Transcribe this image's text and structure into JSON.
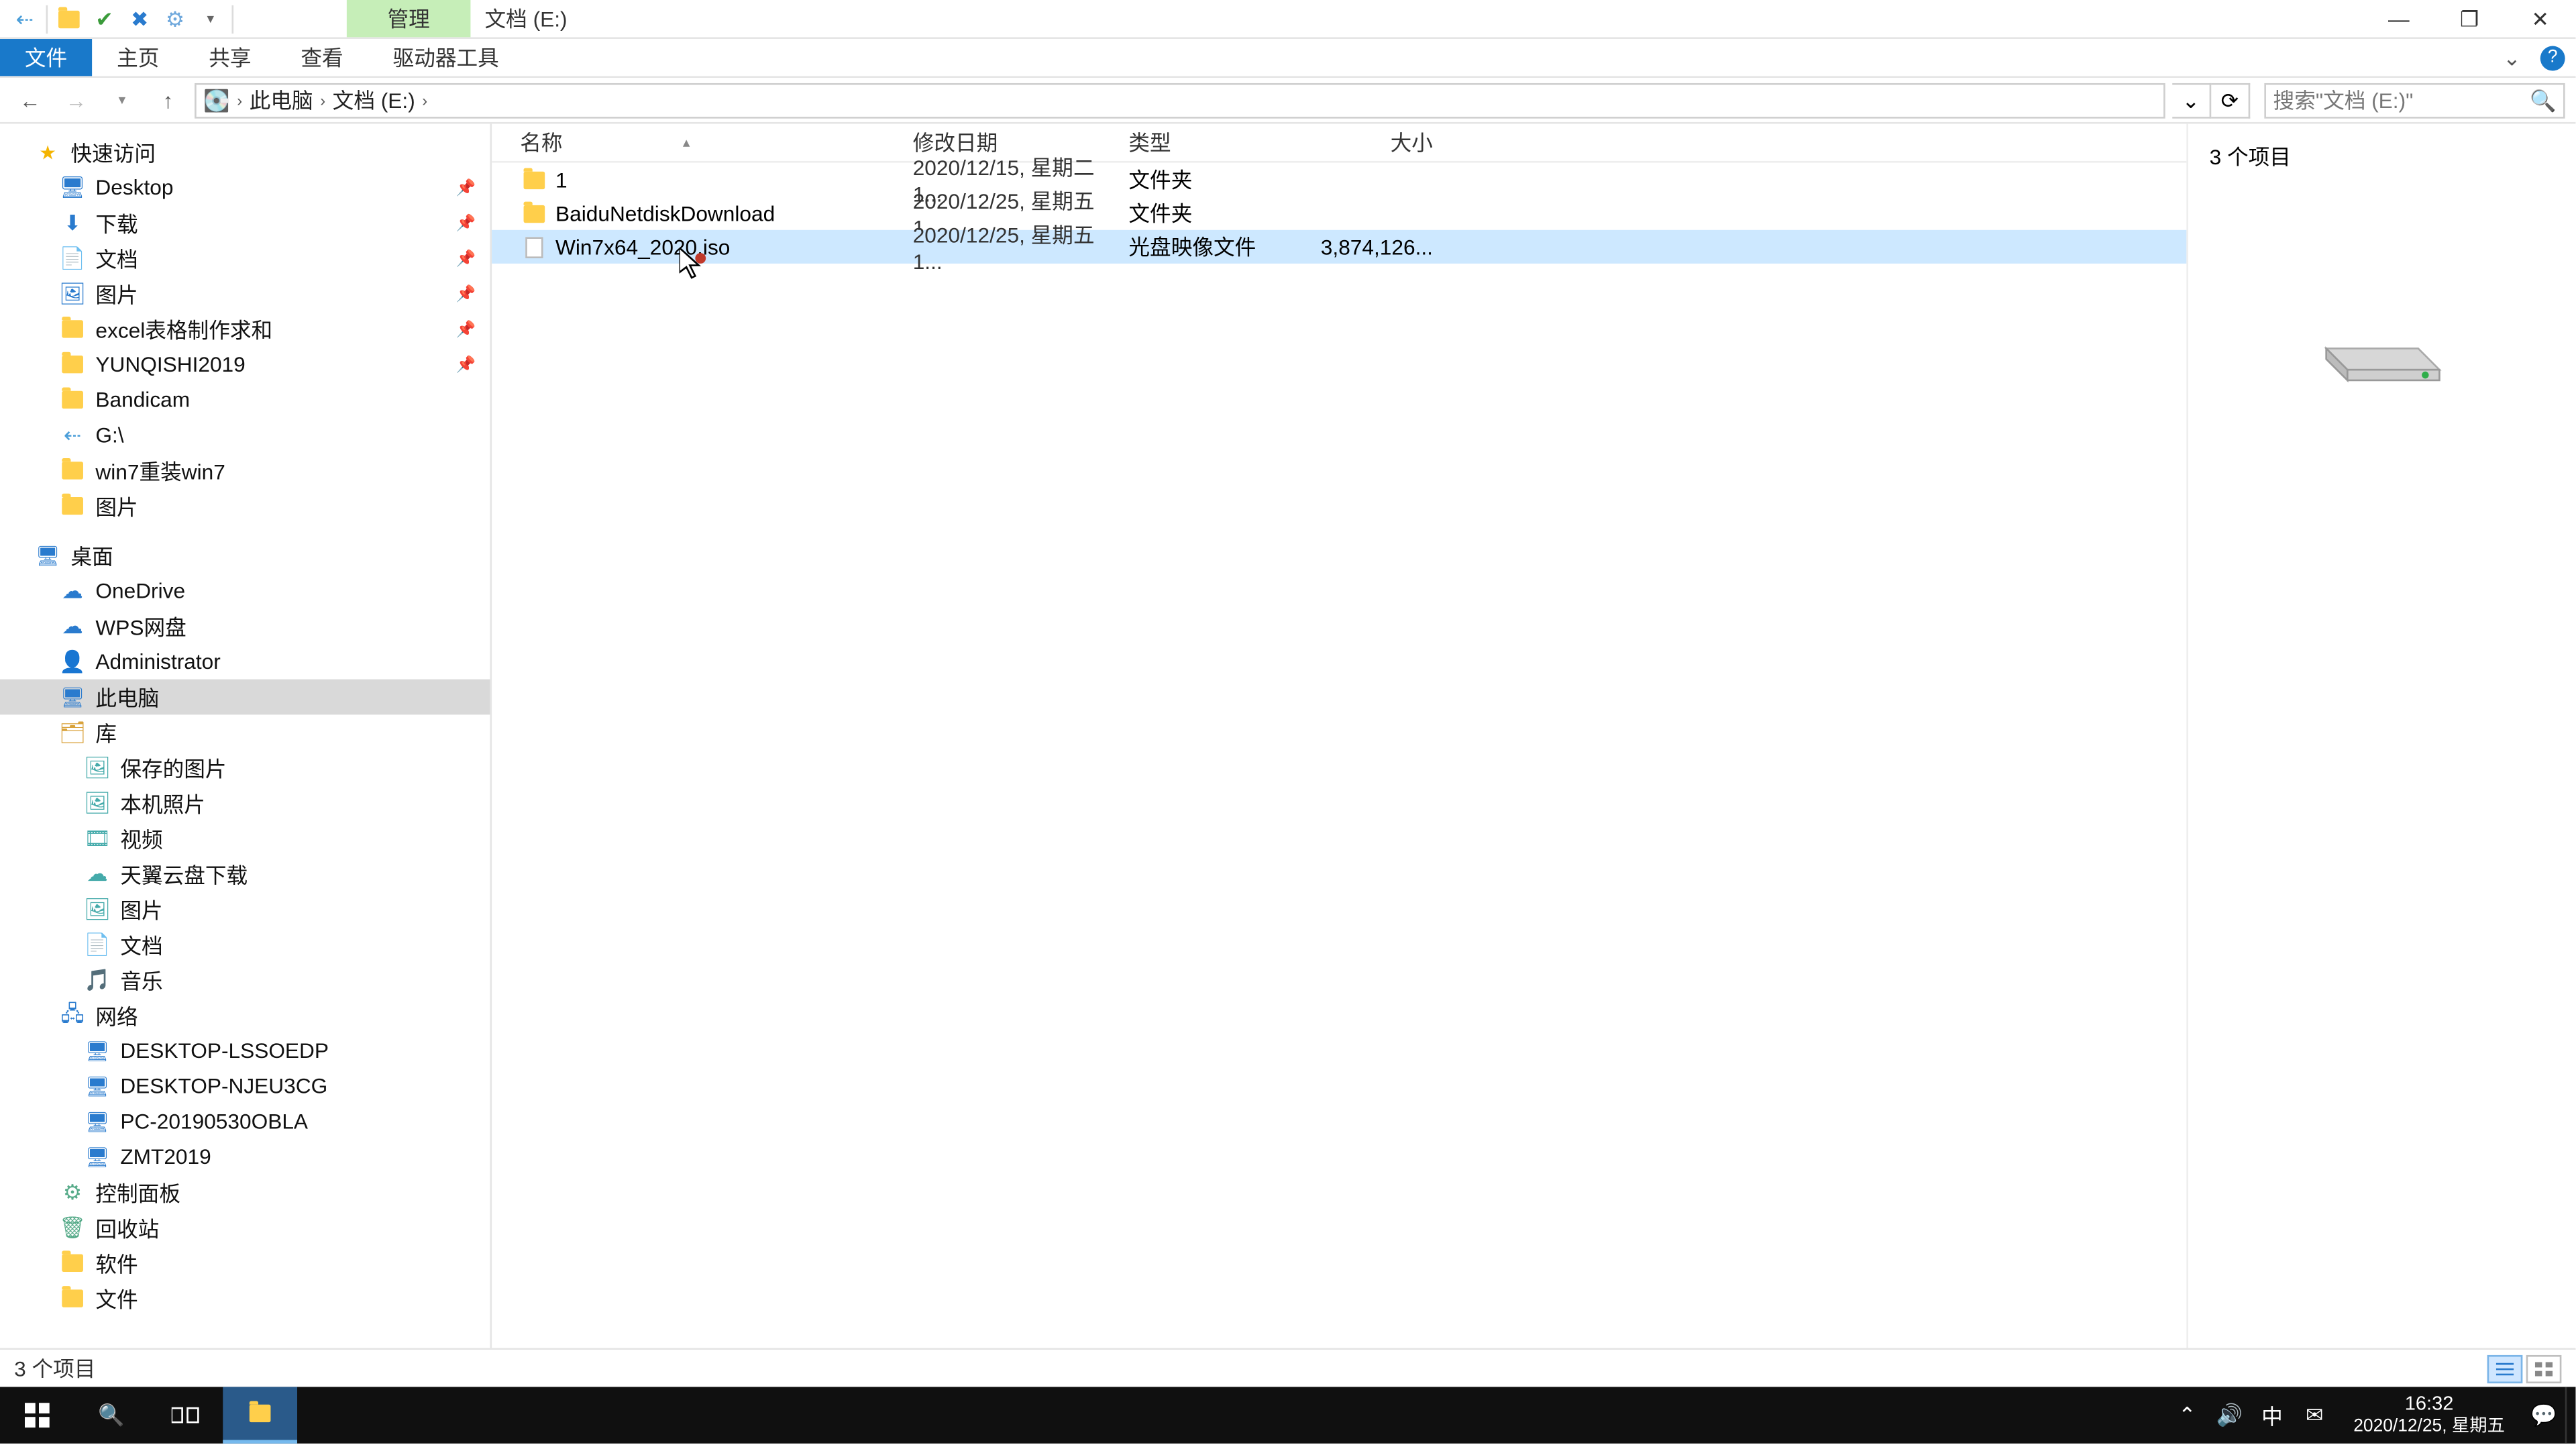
{
  "window": {
    "context_tab": "管理",
    "title": "文档 (E:)",
    "minimize": "—",
    "maximize": "❐",
    "close": "✕"
  },
  "ribbon": {
    "file": "文件",
    "tabs": [
      "主页",
      "共享",
      "查看",
      "驱动器工具"
    ]
  },
  "address": {
    "back": "←",
    "forward": "→",
    "up": "↑",
    "crumbs": [
      "此电脑",
      "文档 (E:)"
    ],
    "dropdown": "⌄",
    "refresh": "⟳"
  },
  "search": {
    "placeholder": "搜索\"文档 (E:)\""
  },
  "nav": {
    "quick": "快速访问",
    "quick_items": [
      {
        "label": "Desktop",
        "pin": true,
        "icon": "desktop"
      },
      {
        "label": "下载",
        "pin": true,
        "icon": "download"
      },
      {
        "label": "文档",
        "pin": true,
        "icon": "doc"
      },
      {
        "label": "图片",
        "pin": true,
        "icon": "pic"
      },
      {
        "label": "excel表格制作求和",
        "pin": true,
        "icon": "folder"
      },
      {
        "label": "YUNQISHI2019",
        "pin": true,
        "icon": "folder"
      },
      {
        "label": "Bandicam",
        "pin": false,
        "icon": "folder"
      },
      {
        "label": "G:\\",
        "pin": false,
        "icon": "drive"
      },
      {
        "label": "win7重装win7",
        "pin": false,
        "icon": "folder"
      },
      {
        "label": "图片",
        "pin": false,
        "icon": "folder"
      }
    ],
    "desktop": "桌面",
    "desktop_items": [
      "OneDrive",
      "WPS网盘",
      "Administrator",
      "此电脑",
      "库"
    ],
    "lib_items": [
      "保存的图片",
      "本机照片",
      "视频",
      "天翼云盘下载",
      "图片",
      "文档",
      "音乐"
    ],
    "network": "网络",
    "network_items": [
      "DESKTOP-LSSOEDP",
      "DESKTOP-NJEU3CG",
      "PC-20190530OBLA",
      "ZMT2019"
    ],
    "tail": [
      "控制面板",
      "回收站",
      "软件",
      "文件"
    ]
  },
  "columns": {
    "name": "名称",
    "date": "修改日期",
    "type": "类型",
    "size": "大小"
  },
  "rows": [
    {
      "name": "1",
      "date": "2020/12/15, 星期二 1...",
      "type": "文件夹",
      "size": "",
      "icon": "folder",
      "selected": false
    },
    {
      "name": "BaiduNetdiskDownload",
      "date": "2020/12/25, 星期五 1...",
      "type": "文件夹",
      "size": "",
      "icon": "folder",
      "selected": false
    },
    {
      "name": "Win7x64_2020.iso",
      "date": "2020/12/25, 星期五 1...",
      "type": "光盘映像文件",
      "size": "3,874,126...",
      "icon": "file",
      "selected": true
    }
  ],
  "preview": {
    "count": "3 个项目"
  },
  "status": {
    "text": "3 个项目"
  },
  "taskbar": {
    "time": "16:32",
    "date": "2020/12/25, 星期五",
    "ime": "中"
  },
  "colors": {
    "accent": "#1979ca",
    "select": "#cde8ff",
    "context": "#c6eeb8"
  }
}
